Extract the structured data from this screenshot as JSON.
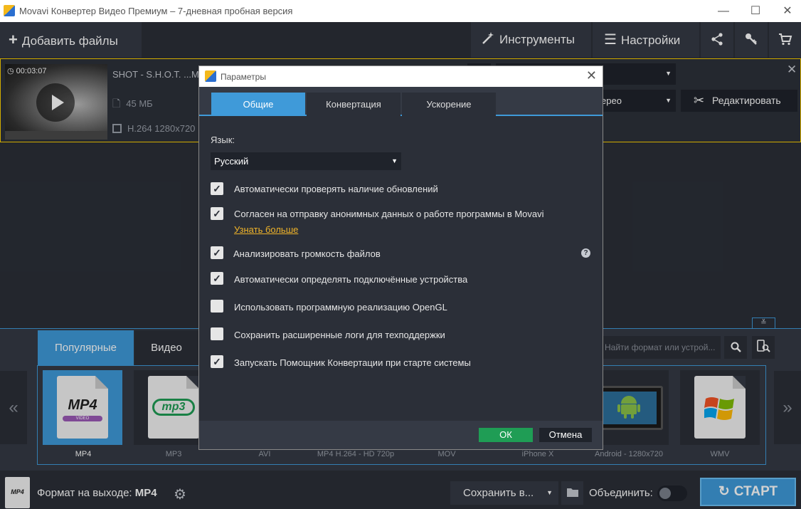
{
  "app": {
    "title": "Movavi Конвертер Видео Премиум – 7-дневная пробная версия"
  },
  "toolbar": {
    "add_files": "Добавить файлы",
    "tools": "Инструменты",
    "settings": "Настройки"
  },
  "file": {
    "duration": "00:03:07",
    "name": "SHOT - S.H.O.T. ...ME",
    "size": "45 МБ",
    "codec": "H.264 1280x720",
    "audio": "ерео",
    "edit_label": "Редактировать"
  },
  "format_panel": {
    "tabs": [
      "Популярные",
      "Видео"
    ],
    "search_placeholder": "Найти формат или устрой...",
    "formats": [
      "MP4",
      "MP3",
      "AVI",
      "MP4 H.264 - HD 720p",
      "MOV",
      "iPhone X",
      "Android - 1280x720",
      "WMV"
    ],
    "mp4_icon_text": "MP4",
    "mp4_icon_sub": "VIDEO",
    "mp3_icon_text": "mp3"
  },
  "status": {
    "output_label": "Формат на выходе:",
    "output_value": "MP4",
    "save_to": "Сохранить в...",
    "merge": "Объединить:",
    "start": "СТАРТ",
    "badge_text": "MP4"
  },
  "dialog": {
    "title": "Параметры",
    "tabs": [
      "Общие",
      "Конвертация",
      "Ускорение"
    ],
    "language_label": "Язык:",
    "language_value": "Русский",
    "options": [
      {
        "label": "Автоматически проверять наличие обновлений",
        "checked": true
      },
      {
        "label": "Согласен на отправку анонимных данных о работе программы в Movavi",
        "checked": true
      },
      {
        "label": "Анализировать громкость файлов",
        "checked": true
      },
      {
        "label": "Автоматически определять подключённые устройства",
        "checked": true
      },
      {
        "label": "Использовать программную реализацию OpenGL",
        "checked": false
      },
      {
        "label": "Сохранить расширенные логи для техподдержки",
        "checked": false
      },
      {
        "label": "Запускать Помощник Конвертации при старте системы",
        "checked": true
      }
    ],
    "learn_more": "Узнать больше",
    "ok": "ОК",
    "cancel": "Отмена"
  },
  "colors": {
    "accent": "#3f9ad9",
    "ok_green": "#1f9d55",
    "highlight": "#ffd200",
    "link": "#f0b429"
  }
}
